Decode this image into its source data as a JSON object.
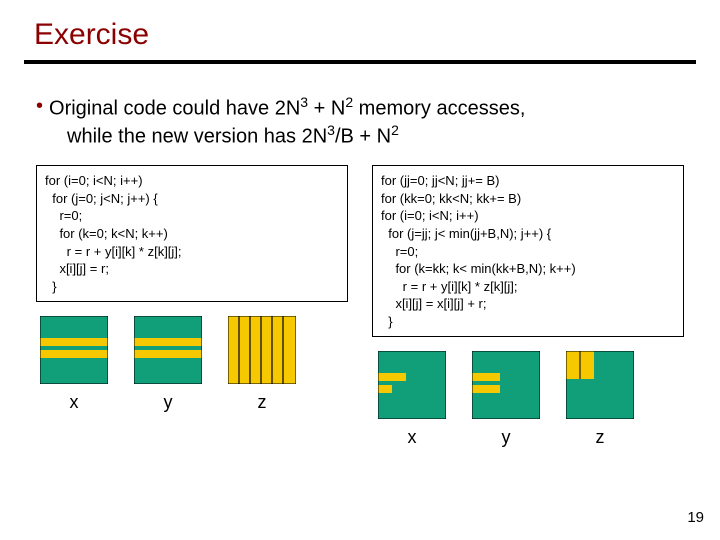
{
  "title": "Exercise",
  "bullet": {
    "line1_pre": "Original code could have 2N",
    "line1_sup1": "3",
    "line1_mid": " + N",
    "line1_sup2": "2",
    "line1_post": " memory accesses,",
    "line2_pre": "while the new version has 2N",
    "line2_sup1": "3",
    "line2_mid": "/B + N",
    "line2_sup2": "2",
    "line2_post": ""
  },
  "code_left": "for (i=0; i<N; i++)\n  for (j=0; j<N; j++) {\n    r=0;\n    for (k=0; k<N; k++)\n      r = r + y[i][k] * z[k][j];\n    x[i][j] = r;\n  }",
  "code_right": "for (jj=0; jj<N; jj+= B)\nfor (kk=0; kk<N; kk+= B)\nfor (i=0; i<N; i++)\n  for (j=jj; j< min(jj+B,N); j++) {\n    r=0;\n    for (k=kk; k< min(kk+B,N); k++)\n      r = r + y[i][k] * z[k][j];\n    x[i][j] = x[i][j] + r;\n  }",
  "labels": {
    "x": "x",
    "y": "y",
    "z": "z"
  },
  "page_number": "19"
}
